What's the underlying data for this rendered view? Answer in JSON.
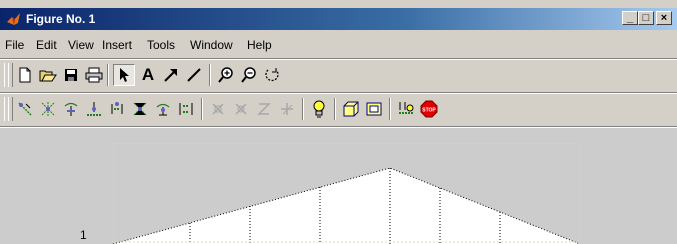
{
  "window": {
    "title": "Figure No. 1",
    "controls": [
      "_",
      "□",
      "×"
    ]
  },
  "menu": [
    "File",
    "Edit",
    "View",
    "Insert",
    "Tools",
    "Window",
    "Help"
  ],
  "toolbar1": [
    {
      "name": "new-figure-icon",
      "glyph": "🗋"
    },
    {
      "name": "open-file-icon",
      "glyph": "📂"
    },
    {
      "name": "save-icon",
      "glyph": "💾"
    },
    {
      "name": "print-icon",
      "glyph": "🖶"
    },
    {
      "name": "select-arrow-icon",
      "glyph": "➤"
    },
    {
      "name": "insert-text-icon",
      "glyph": "A"
    },
    {
      "name": "insert-arrow-icon",
      "glyph": "↗"
    },
    {
      "name": "insert-line-icon",
      "glyph": "╱"
    },
    {
      "name": "zoom-in-icon",
      "glyph": "⊕"
    },
    {
      "name": "zoom-out-icon",
      "glyph": "⊖"
    },
    {
      "name": "rotate-icon",
      "glyph": "↻"
    }
  ],
  "plot": {
    "y_tick_label": "1"
  }
}
